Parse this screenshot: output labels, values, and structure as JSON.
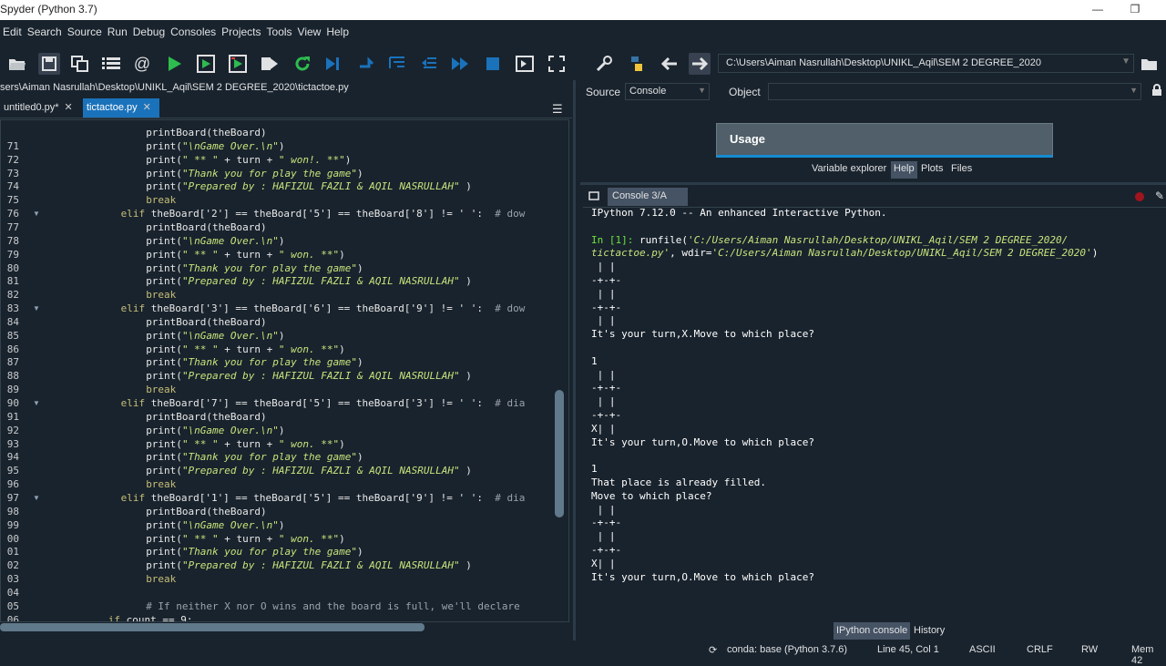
{
  "window": {
    "title": "Spyder (Python 3.7)",
    "minimize": "—",
    "maximize": "❐"
  },
  "menu": [
    "Edit",
    "Search",
    "Source",
    "Run",
    "Debug",
    "Consoles",
    "Projects",
    "Tools",
    "View",
    "Help"
  ],
  "toolbar": {
    "path": "C:\\Users\\Aiman Nasrullah\\Desktop\\UNIKL_Aqil\\SEM 2 DEGREE_2020"
  },
  "editor": {
    "file_path": "sers\\Aiman Nasrullah\\Desktop\\UNIKL_Aqil\\SEM 2 DEGREE_2020\\tictactoe.py",
    "tabs": [
      {
        "label": "untitled0.py*",
        "close": "✕"
      },
      {
        "label": "tictactoe.py",
        "close": "✕"
      }
    ],
    "lines": [
      {
        "n": "",
        "ind": 8,
        "t": "printBoard(theBoard)"
      },
      {
        "n": "71",
        "ind": 8,
        "t": "print(\"\\nGame Over.\\n\")"
      },
      {
        "n": "72",
        "ind": 8,
        "t": "print(\" ** \" + turn + \" won!. **\")"
      },
      {
        "n": "73",
        "ind": 8,
        "t": "print(\"Thank you for play the game\")"
      },
      {
        "n": "74",
        "ind": 8,
        "t": "print(\"Prepared by : HAFIZUL FAZLI & AQIL NASRULLAH\" )"
      },
      {
        "n": "75",
        "ind": 8,
        "t": "break"
      },
      {
        "n": "76",
        "ind": 4,
        "t": "elif theBoard['2'] == theBoard['5'] == theBoard['8'] != ' ':  # dow"
      },
      {
        "n": "77",
        "ind": 8,
        "t": "printBoard(theBoard)"
      },
      {
        "n": "78",
        "ind": 8,
        "t": "print(\"\\nGame Over.\\n\")"
      },
      {
        "n": "79",
        "ind": 8,
        "t": "print(\" ** \" + turn + \" won. **\")"
      },
      {
        "n": "80",
        "ind": 8,
        "t": "print(\"Thank you for play the game\")"
      },
      {
        "n": "81",
        "ind": 8,
        "t": "print(\"Prepared by : HAFIZUL FAZLI & AQIL NASRULLAH\" )"
      },
      {
        "n": "82",
        "ind": 8,
        "t": "break"
      },
      {
        "n": "83",
        "ind": 4,
        "t": "elif theBoard['3'] == theBoard['6'] == theBoard['9'] != ' ':  # dow"
      },
      {
        "n": "84",
        "ind": 8,
        "t": "printBoard(theBoard)"
      },
      {
        "n": "85",
        "ind": 8,
        "t": "print(\"\\nGame Over.\\n\")"
      },
      {
        "n": "86",
        "ind": 8,
        "t": "print(\" ** \" + turn + \" won. **\")"
      },
      {
        "n": "87",
        "ind": 8,
        "t": "print(\"Thank you for play the game\")"
      },
      {
        "n": "88",
        "ind": 8,
        "t": "print(\"Prepared by : HAFIZUL FAZLI & AQIL NASRULLAH\" )"
      },
      {
        "n": "89",
        "ind": 8,
        "t": "break"
      },
      {
        "n": "90",
        "ind": 4,
        "t": "elif theBoard['7'] == theBoard['5'] == theBoard['3'] != ' ':  # dia"
      },
      {
        "n": "91",
        "ind": 8,
        "t": "printBoard(theBoard)"
      },
      {
        "n": "92",
        "ind": 8,
        "t": "print(\"\\nGame Over.\\n\")"
      },
      {
        "n": "93",
        "ind": 8,
        "t": "print(\" ** \" + turn + \" won. **\")"
      },
      {
        "n": "94",
        "ind": 8,
        "t": "print(\"Thank you for play the game\")"
      },
      {
        "n": "95",
        "ind": 8,
        "t": "print(\"Prepared by : HAFIZUL FAZLI & AQIL NASRULLAH\" )"
      },
      {
        "n": "96",
        "ind": 8,
        "t": "break"
      },
      {
        "n": "97",
        "ind": 4,
        "t": "elif theBoard['1'] == theBoard['5'] == theBoard['9'] != ' ':  # dia"
      },
      {
        "n": "98",
        "ind": 8,
        "t": "printBoard(theBoard)"
      },
      {
        "n": "99",
        "ind": 8,
        "t": "print(\"\\nGame Over.\\n\")"
      },
      {
        "n": "00",
        "ind": 8,
        "t": "print(\" ** \" + turn + \" won. **\")"
      },
      {
        "n": "01",
        "ind": 8,
        "t": "print(\"Thank you for play the game\")"
      },
      {
        "n": "02",
        "ind": 8,
        "t": "print(\"Prepared by : HAFIZUL FAZLI & AQIL NASRULLAH\" )"
      },
      {
        "n": "03",
        "ind": 8,
        "t": "break"
      },
      {
        "n": "04",
        "ind": 0,
        "t": ""
      },
      {
        "n": "05",
        "ind": 8,
        "t": "# If neither X nor O wins and the board is full, we'll declare"
      },
      {
        "n": "06",
        "ind": 2,
        "t": "if count == 9:"
      }
    ]
  },
  "right_top": {
    "source_label": "Source",
    "source_value": "Console",
    "object_label": "Object",
    "usage_title": "Usage",
    "tabs": [
      "Variable explorer",
      "Help",
      "Plots",
      "Files"
    ]
  },
  "console": {
    "tab_label": "Console 3/A",
    "lines": [
      {
        "c": "w",
        "t": "IPython 7.12.0 -- An enhanced Interactive Python."
      },
      {
        "c": "w",
        "t": ""
      },
      {
        "c": "run",
        "t": "In [1]: ",
        "a": "runfile(",
        "b": "'C:/Users/Aiman Nasrullah/Desktop/UNIKL_Aqil/SEM 2 DEGREE_2020/"
      },
      {
        "c": "run2",
        "t": "tictactoe.py'",
        "a": ", wdir=",
        "b": "'C:/Users/Aiman Nasrullah/Desktop/UNIKL_Aqil/SEM 2 DEGREE_2020'",
        "d": ")"
      },
      {
        "c": "w",
        "t": " | |"
      },
      {
        "c": "w",
        "t": "-+-+-"
      },
      {
        "c": "w",
        "t": " | |"
      },
      {
        "c": "w",
        "t": "-+-+-"
      },
      {
        "c": "w",
        "t": " | |"
      },
      {
        "c": "w",
        "t": "It's your turn,X.Move to which place?"
      },
      {
        "c": "w",
        "t": ""
      },
      {
        "c": "w",
        "t": "1"
      },
      {
        "c": "w",
        "t": " | |"
      },
      {
        "c": "w",
        "t": "-+-+-"
      },
      {
        "c": "w",
        "t": " | |"
      },
      {
        "c": "w",
        "t": "-+-+-"
      },
      {
        "c": "w",
        "t": "X| |"
      },
      {
        "c": "w",
        "t": "It's your turn,O.Move to which place?"
      },
      {
        "c": "w",
        "t": ""
      },
      {
        "c": "w",
        "t": "1"
      },
      {
        "c": "w",
        "t": "That place is already filled."
      },
      {
        "c": "w",
        "t": "Move to which place?"
      },
      {
        "c": "w",
        "t": " | |"
      },
      {
        "c": "w",
        "t": "-+-+-"
      },
      {
        "c": "w",
        "t": " | |"
      },
      {
        "c": "w",
        "t": "-+-+-"
      },
      {
        "c": "w",
        "t": "X| |"
      },
      {
        "c": "w",
        "t": "It's your turn,O.Move to which place?"
      }
    ],
    "bottom_tabs": [
      "IPython console",
      "History"
    ]
  },
  "status": {
    "conda": "conda: base (Python 3.7.6)",
    "position": "Line 45, Col 1",
    "encoding": "ASCII",
    "eol": "CRLF",
    "rw": "RW",
    "mem": "Mem 42"
  },
  "colors": {
    "background": "#19232d",
    "accent": "#1a72bb",
    "keyword": "#c7bf78",
    "string": "#c6e47c",
    "prompt": "#6ee23d"
  }
}
